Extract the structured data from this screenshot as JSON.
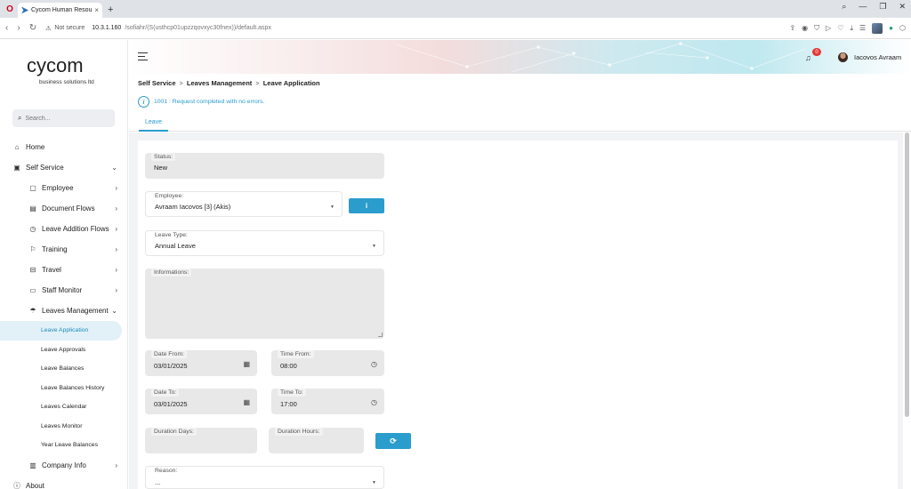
{
  "browser": {
    "tab_title": "Cycom Human Resources",
    "tab_close": "×",
    "new_tab": "+",
    "not_secure": "Not secure",
    "url_host": "10.3.1.160",
    "url_path": "/sofiahr/(S(usthcp01upzzqovxyc30fnex))/default.aspx"
  },
  "sidebar": {
    "logo_text": "cycom",
    "logo_subtitle": "business solutions ltd",
    "search_placeholder": "Search...",
    "items": [
      {
        "label": "Home",
        "level": "top",
        "icon": "home-icon"
      },
      {
        "label": "Self Service",
        "level": "top",
        "icon": "id-card-icon",
        "expanded": true
      },
      {
        "label": "Employee",
        "level": "sub",
        "icon": "id-badge-icon"
      },
      {
        "label": "Document Flows",
        "level": "sub",
        "icon": "document-icon"
      },
      {
        "label": "Leave Addition Flows",
        "level": "sub",
        "icon": "clock-icon"
      },
      {
        "label": "Training",
        "level": "sub",
        "icon": "training-icon"
      },
      {
        "label": "Travel",
        "level": "sub",
        "icon": "suitcase-icon"
      },
      {
        "label": "Staff Monitor",
        "level": "sub",
        "icon": "monitor-icon"
      },
      {
        "label": "Leaves Management",
        "level": "sub",
        "icon": "umbrella-beach-icon",
        "expanded": true
      }
    ],
    "leaves": [
      "Leave Application",
      "Leave Approvals",
      "Leave Balances",
      "Leave Balances History",
      "Leaves Calendar",
      "Leaves Monitor",
      "Year Leave Balances"
    ],
    "company_info": "Company Info",
    "about": "About"
  },
  "header": {
    "notification_count": "0",
    "user_name": "Iacovos Avraam"
  },
  "breadcrumb": [
    "Self Service",
    "Leaves Management",
    "Leave Application"
  ],
  "breadcrumb_sep": ">",
  "message": {
    "icon": "i",
    "text": "1001 : Request completed with no errors."
  },
  "tabs": [
    "Leave"
  ],
  "form": {
    "status_label": "Status:",
    "status_value": "New",
    "employee_label": "Employee:",
    "employee_value": "Avraam Iacovos [3] (Akis)",
    "info_button": "i",
    "leave_type_label": "Leave Type:",
    "leave_type_value": "Annual Leave",
    "informations_label": "Informations:",
    "date_from_label": "Date From:",
    "date_from_value": "03/01/2025",
    "time_from_label": "Time From:",
    "time_from_value": "08:00",
    "date_to_label": "Date To:",
    "date_to_value": "03/01/2025",
    "time_to_label": "Time To:",
    "time_to_value": "17:00",
    "duration_days_label": "Duration Days:",
    "duration_hours_label": "Duration Hours:",
    "reason_label": "Reason:",
    "reason_value": "..."
  },
  "colors": {
    "accent": "#2a9dcc",
    "badge": "#e53935",
    "active_bg": "#e2f1f8"
  }
}
